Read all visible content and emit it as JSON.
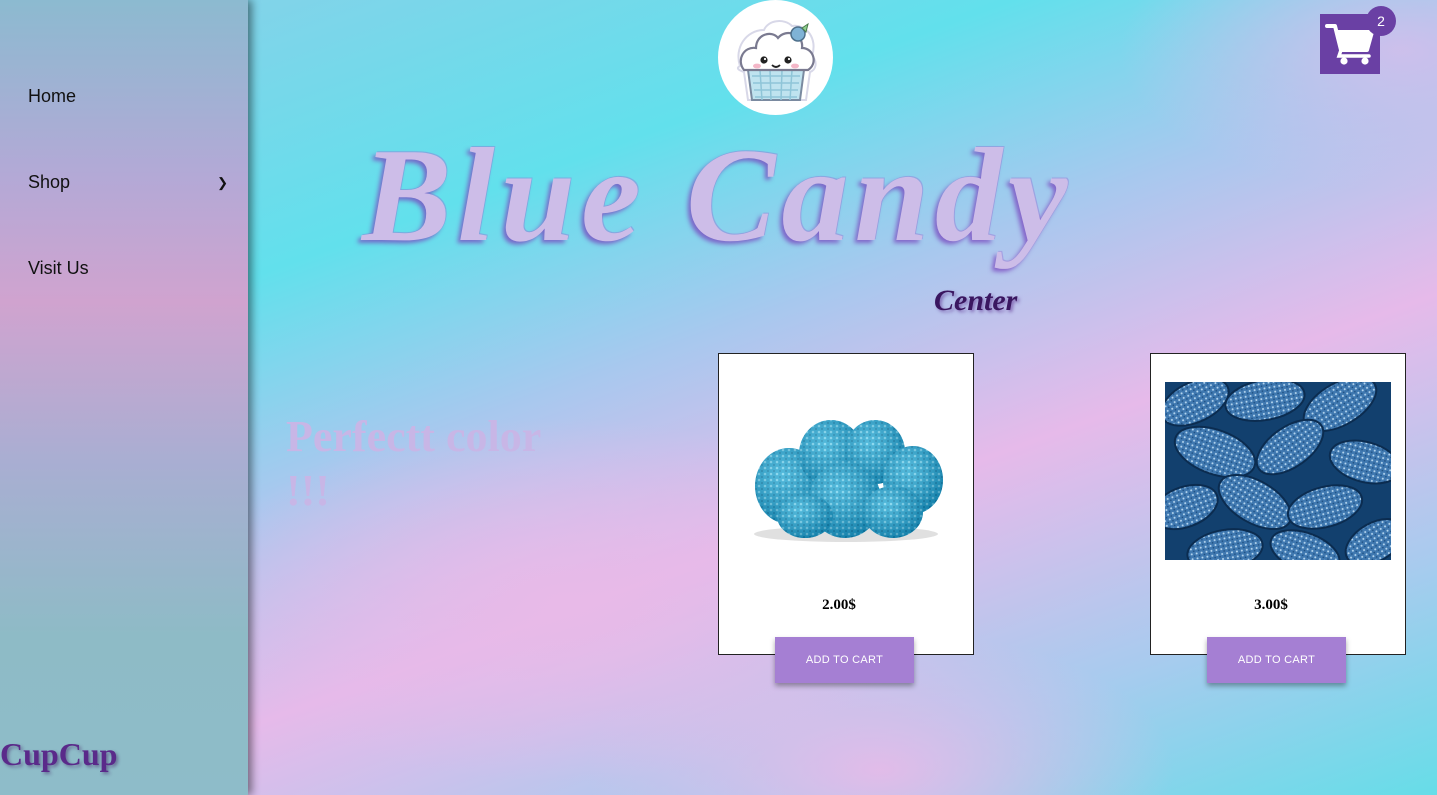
{
  "sidebar": {
    "items": [
      {
        "label": "Home"
      },
      {
        "label": "Shop",
        "submenu_indicator": "›"
      },
      {
        "label": "Visit Us"
      }
    ],
    "footer_brand": "CupCup"
  },
  "cart": {
    "icon": "shopping-cart-icon",
    "count": "2"
  },
  "logo": {
    "icon": "cupcake-mascot-icon"
  },
  "hero": {
    "title": "Blue Candy",
    "subtitle": "Center"
  },
  "tagline": "Perfectt color !!!",
  "products": [
    {
      "price": "2.00$",
      "button_label": "ADD TO CART",
      "image": "blue-gummy-candies"
    },
    {
      "price": "3.00$",
      "button_label": "ADD TO CART",
      "image": "blue-sour-candy-pile"
    }
  ],
  "colors": {
    "accent_purple": "#6a40a4",
    "button_purple": "#a57fd3",
    "title_lavender": "#cdbde8"
  }
}
